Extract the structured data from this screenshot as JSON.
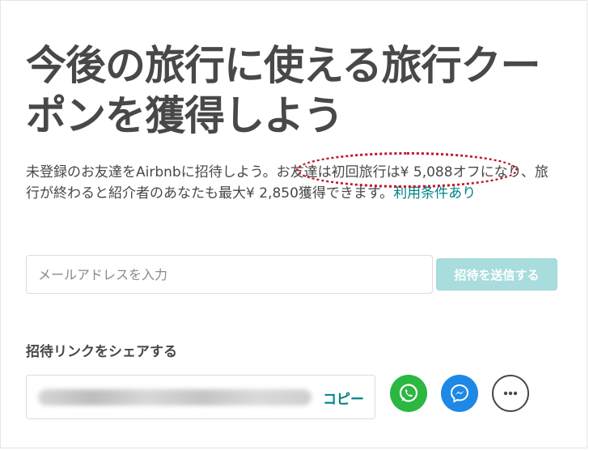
{
  "headline": "今後の旅行に使える旅行クーポンを獲得しよう",
  "description": {
    "text": "未登録のお友達をAirbnbに招待しよう。お友達は初回旅行は¥ 5,088オフになり、旅行が終わると紹介者のあなたも最大¥ 2,850獲得できます。",
    "terms_link": "利用条件あり"
  },
  "invite": {
    "email_placeholder": "メールアドレスを入力",
    "email_value": "",
    "send_label": "招待を送信する"
  },
  "share": {
    "title": "招待リンクをシェアする",
    "copy_label": "コピー",
    "buttons": [
      {
        "icon": "whatsapp-icon",
        "color": "#2bb741"
      },
      {
        "icon": "messenger-icon",
        "color": "#1e88e5"
      },
      {
        "icon": "more-icon",
        "color": "#484848"
      }
    ]
  },
  "colors": {
    "text": "#484848",
    "accent": "#008489",
    "send_button_disabled": "#a9dcdc",
    "highlight_annotation": "#c0152a"
  }
}
